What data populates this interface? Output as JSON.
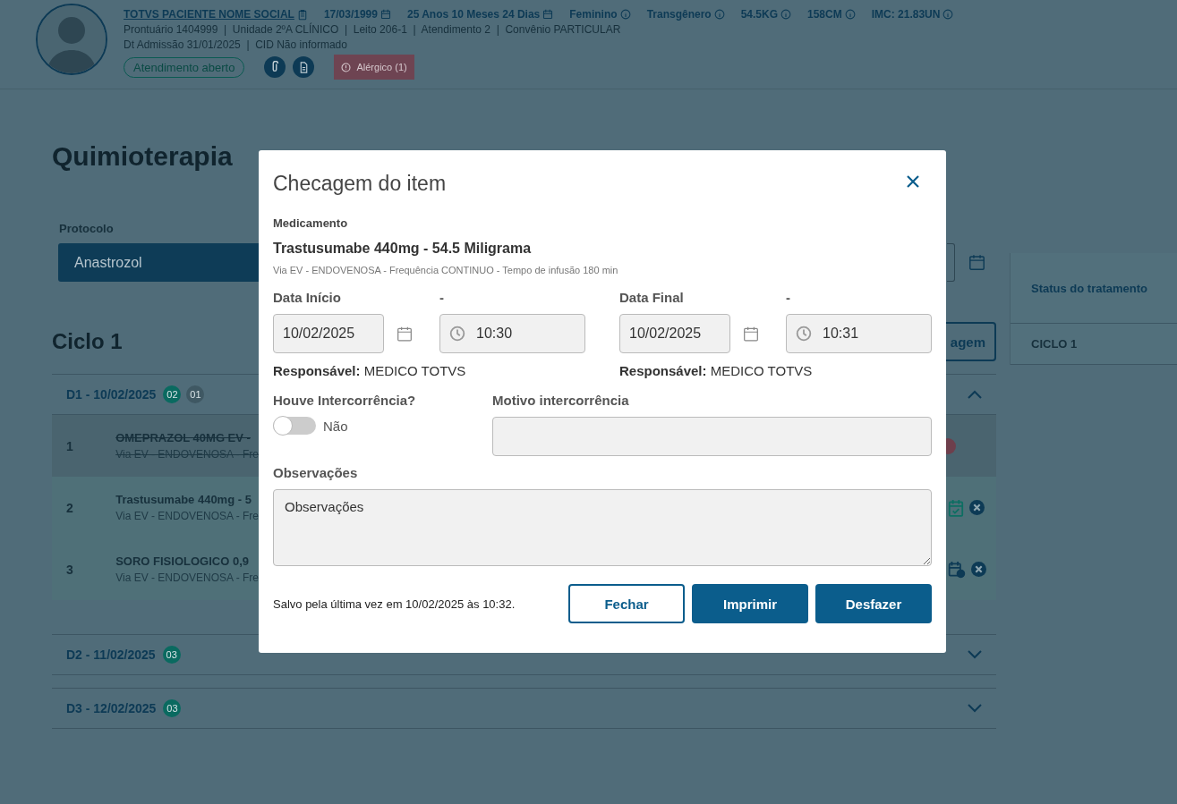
{
  "header": {
    "patient_name": "TOTVS PACIENTE NOME SOCIAL",
    "facts": [
      "17/03/1999",
      "25 Anos 10 Meses 24 Dias",
      "Feminino",
      "Transgênero",
      "54.5KG",
      "158CM",
      "IMC: 21.83UN"
    ],
    "lines": [
      "Prontuário 1404999  |  Unidade 2ºA CLÍNICO  |  Leito 206-1  |  Atendimento 2  |  Convênio PARTICULAR",
      "Dt Admissão 31/01/2025  |  CID Não informado"
    ],
    "status_badge": "Atendimento aberto",
    "allergy": "Alérgico (1)"
  },
  "page": {
    "title": "Quimioterapia",
    "protocol": {
      "label": "Protocolo",
      "value": "Anastrozol"
    },
    "cycle": {
      "title": "Ciclo 1",
      "button_label": "agem",
      "days": [
        {
          "label": "D1 - 10/02/2025",
          "expanded": true,
          "badges": [
            {
              "text": "02",
              "color": "#0a6a60"
            },
            {
              "text": "01",
              "color": "#3f5863"
            }
          ],
          "items": [
            {
              "kind": "cancelled",
              "number": "1",
              "name": "OMEPRAZOL 40MG EV -",
              "detail": "Via EV - ENDOVENOSA - Fre",
              "struck": true
            },
            {
              "kind": "checked",
              "number": "2",
              "name": "Trastusumabe 440mg - 5",
              "detail": "Via EV - ENDOVENOSA - Fre",
              "struck": false
            },
            {
              "kind": "scheduled",
              "number": "3",
              "name": "SORO FISIOLOGICO 0,9",
              "detail": "Via EV - ENDOVENOSA - Fre",
              "struck": false
            }
          ]
        },
        {
          "label": "D2 - 11/02/2025",
          "expanded": false,
          "badges": [
            {
              "text": "03",
              "color": "#0a6a60"
            }
          ]
        },
        {
          "label": "D3 - 12/02/2025",
          "expanded": false,
          "badges": [
            {
              "text": "03",
              "color": "#0a6a60"
            }
          ]
        }
      ]
    },
    "side_panel": {
      "title": "Status do tratamento",
      "items": [
        "CICLO 1"
      ]
    }
  },
  "modal": {
    "title": "Checagem do item",
    "medication_label": "Medicamento",
    "medication_name": "Trastusumabe 440mg - 54.5 Miligrama",
    "medication_detail": "Via EV - ENDOVENOSA - Frequência CONTINUO - Tempo de infusão 180 min",
    "periods": [
      {
        "label": "Data Início",
        "time_label": "-",
        "date": "10/02/2025",
        "time": "10:30",
        "responsible": "**Responsável:** MEDICO TOTVS"
      },
      {
        "label": "Data Final",
        "time_label": "-",
        "date": "10/02/2025",
        "time": "10:31",
        "responsible": "**Responsável:** MEDICO TOTVS"
      }
    ],
    "intercurrence": {
      "label": "Houve Intercorrência?",
      "on": false,
      "state_text": "Não"
    },
    "reason": {
      "label": "Motivo intercorrência",
      "disabled": true
    },
    "observations": {
      "label": "Observações",
      "placeholder": "Observações"
    },
    "saved_text": "Salvo pela última vez em 10/02/2025 às 10:32.",
    "buttons": [
      {
        "label": "Fechar",
        "kind": "outline"
      },
      {
        "label": "Imprimir",
        "kind": "primary"
      },
      {
        "label": "Desfazer",
        "kind": "primary"
      }
    ]
  }
}
